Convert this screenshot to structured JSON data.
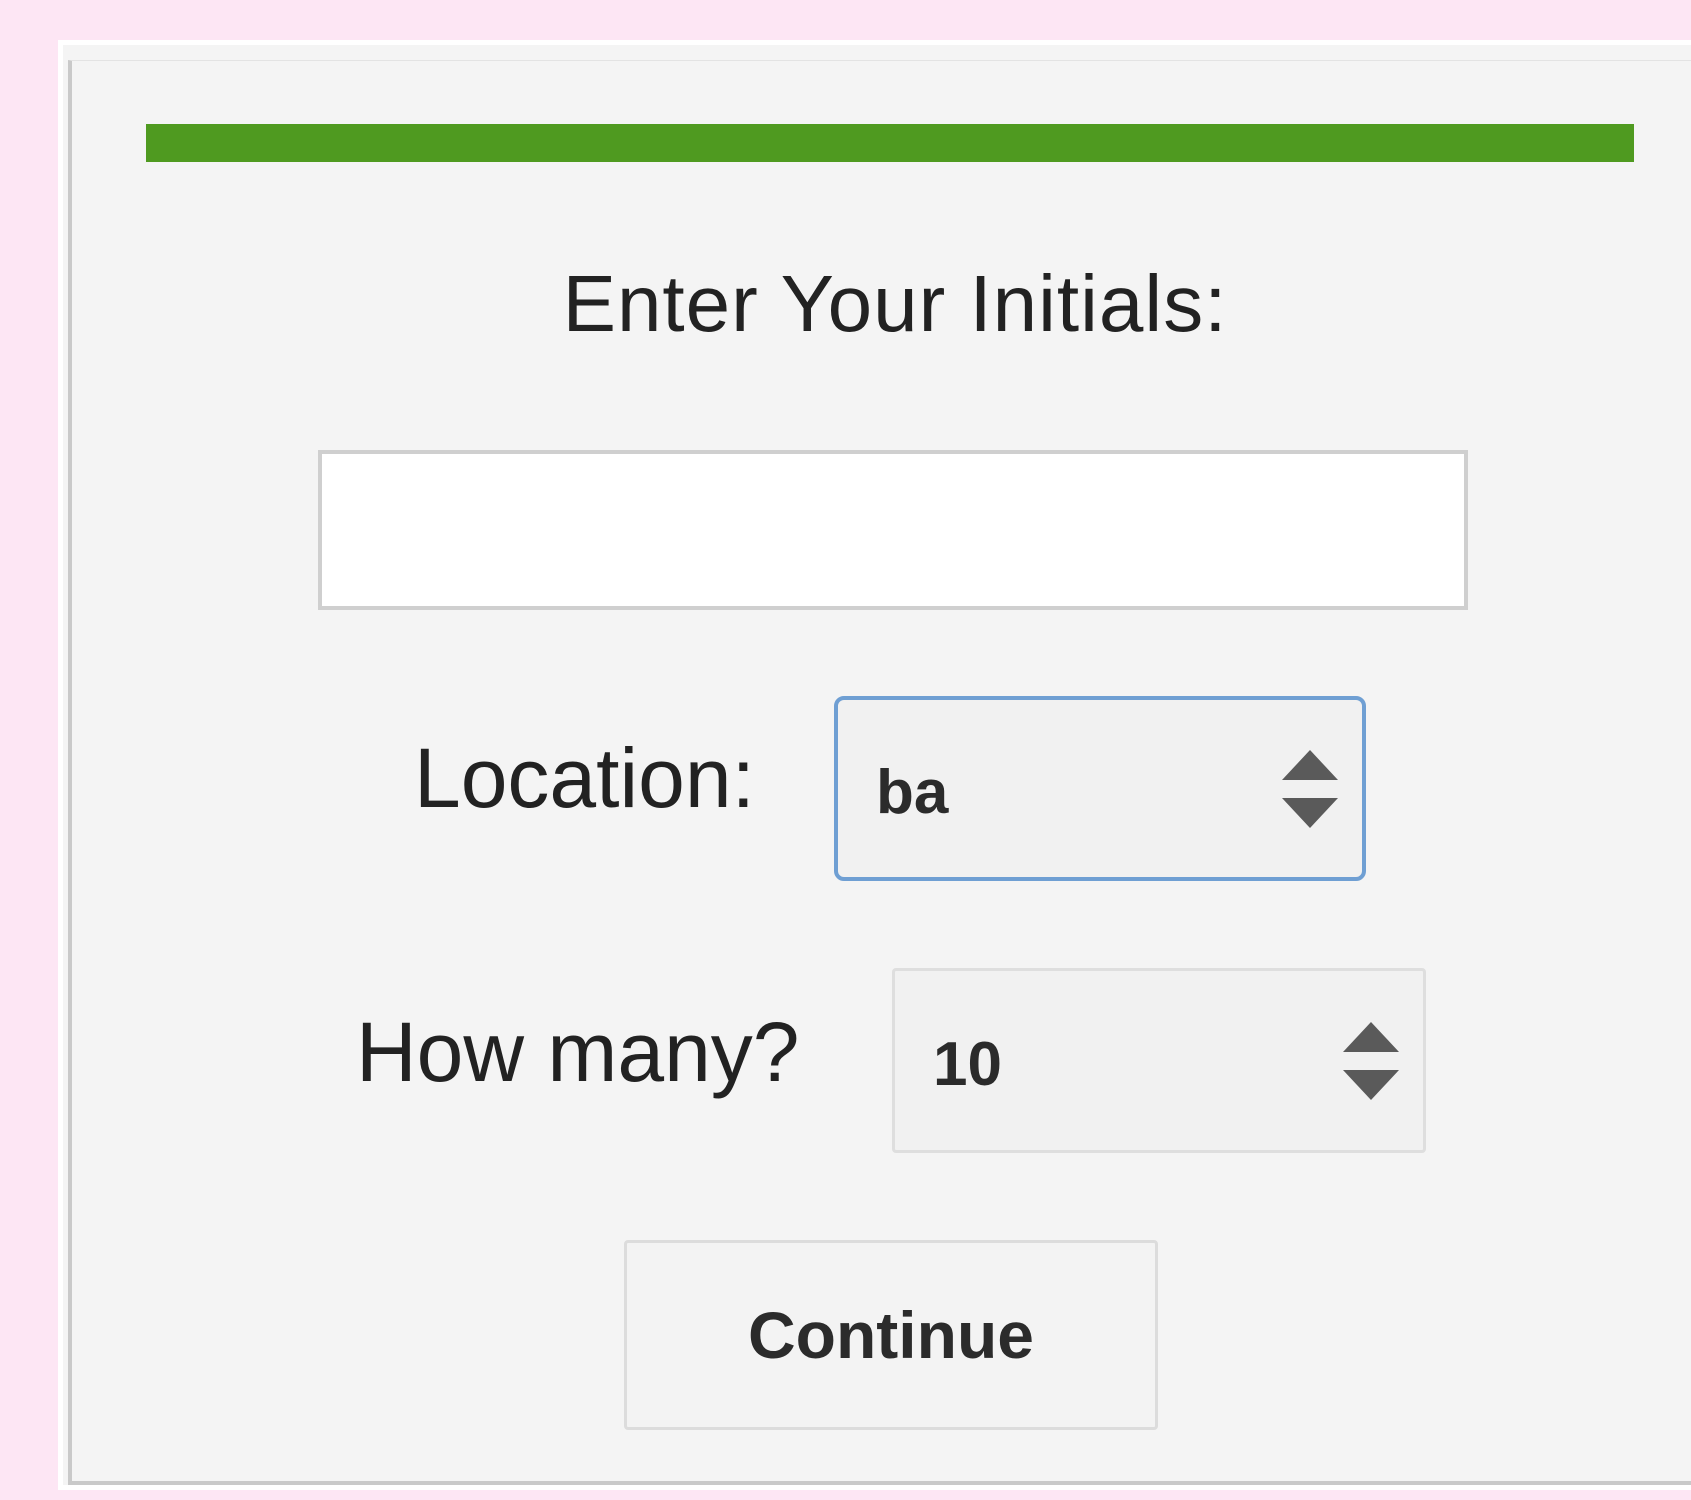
{
  "progress": {
    "fraction": 1.0,
    "fill_color": "#4f9a20"
  },
  "form": {
    "title": "Enter Your Initials:",
    "initials_value": "",
    "location_label": "Location:",
    "location_value": "ba",
    "count_label": "How many?",
    "count_value": "10",
    "continue_label": "Continue"
  },
  "colors": {
    "page_background": "#fde6f4",
    "panel_background": "#f4f4f4",
    "focus_border": "#6f9fd3"
  }
}
